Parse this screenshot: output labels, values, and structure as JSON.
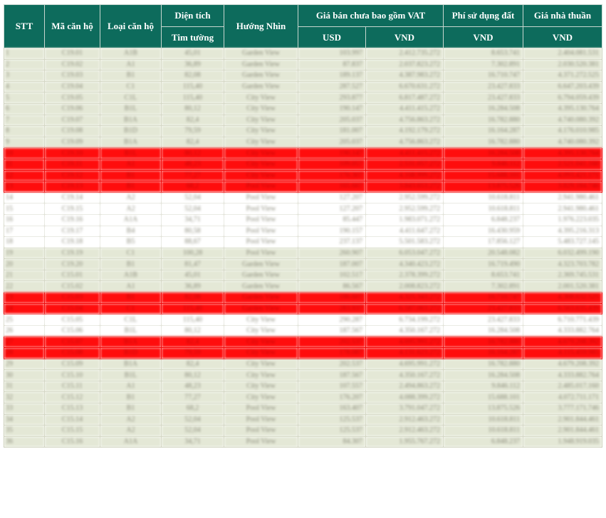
{
  "headers": {
    "stt": "STT",
    "ma_can_ho": "Mã căn hộ",
    "loai_can_ho": "Loại căn hộ",
    "dien_tich": "Diện tích",
    "tim_tuong": "Tim tường",
    "huong_nhin": "Hướng Nhìn",
    "gia_ban": "Giá bán chưa bao gồm VAT",
    "usd": "USD",
    "vnd": "VND",
    "phi_su_dung_dat": "Phí sử dụng đất",
    "phi_vnd": "VND",
    "gia_nha_thuan": "Giá nhà thuần",
    "gia_vnd": "VND"
  },
  "row_colors": {
    "normal": "#e4e8d6",
    "highlight_red": "#ff0d0d",
    "white": "#ffffff",
    "header_bg": "#0d6b5c"
  },
  "rows": [
    {
      "stt": "1",
      "ma": "C19.01",
      "loai": "A1B",
      "dt": "45,01",
      "huong": "Garden View",
      "usd": "103.997",
      "vnd": "2.412.735.272",
      "phi": "8.653.741",
      "gia": "2.404.081.531",
      "status": "green"
    },
    {
      "stt": "2",
      "ma": "C19.02",
      "loai": "A1",
      "dt": "36,89",
      "huong": "Garden View",
      "usd": "87.837",
      "vnd": "2.037.823.272",
      "phi": "7.302.891",
      "gia": "2.030.520.381",
      "status": "green"
    },
    {
      "stt": "3",
      "ma": "C19.03",
      "loai": "B1",
      "dt": "82,08",
      "huong": "Garden View",
      "usd": "189.137",
      "vnd": "4.387.983.272",
      "phi": "16.710.747",
      "gia": "4.371.272.525",
      "status": "green"
    },
    {
      "stt": "4",
      "ma": "C19.04",
      "loai": "C1",
      "dt": "115,40",
      "huong": "Garden View",
      "usd": "287.527",
      "vnd": "6.670.631.272",
      "phi": "23.427.833",
      "gia": "6.647.203.439",
      "status": "green"
    },
    {
      "stt": "5",
      "ma": "C19.05",
      "loai": "C1L",
      "dt": "115,40",
      "huong": "City View",
      "usd": "293.877",
      "vnd": "6.817.487.272",
      "phi": "23.427.833",
      "gia": "6.794.059.439",
      "status": "green"
    },
    {
      "stt": "6",
      "ma": "C19.06",
      "loai": "B1L",
      "dt": "80,12",
      "huong": "City View",
      "usd": "190.147",
      "vnd": "4.411.415.272",
      "phi": "16.284.508",
      "gia": "4.395.130.764",
      "status": "green"
    },
    {
      "stt": "7",
      "ma": "C19.07",
      "loai": "B1A",
      "dt": "82,4",
      "huong": "City View",
      "usd": "205.037",
      "vnd": "4.756.863.272",
      "phi": "16.782.880",
      "gia": "4.740.080.392",
      "status": "green"
    },
    {
      "stt": "8",
      "ma": "C19.08",
      "loai": "B1D",
      "dt": "79,59",
      "huong": "City View",
      "usd": "181.007",
      "vnd": "4.192.179.272",
      "phi": "16.164.287",
      "gia": "4.176.010.985",
      "status": "green"
    },
    {
      "stt": "9",
      "ma": "C19.09",
      "loai": "B1A",
      "dt": "82,4",
      "huong": "City View",
      "usd": "205.037",
      "vnd": "4.756.863.272",
      "phi": "16.782.880",
      "gia": "4.740.080.392",
      "status": "green"
    },
    {
      "stt": "10",
      "ma": "C19.10",
      "loai": "B1L",
      "dt": "80,12",
      "huong": "City View",
      "usd": "190.147",
      "vnd": "4.411.415.272",
      "phi": "16.284.508",
      "gia": "4.395.130.764",
      "status": "red"
    },
    {
      "stt": "11",
      "ma": "C19.11",
      "loai": "A1",
      "dt": "48,23",
      "huong": "City View",
      "usd": "109.057",
      "vnd": "2.531.057.272",
      "phi": "9.846.112",
      "gia": "2.521.041.160",
      "status": "red"
    },
    {
      "stt": "12",
      "ma": "C19.12",
      "loai": "B1",
      "dt": "77,27",
      "huong": "City View",
      "usd": "176.307",
      "vnd": "4.108.999.272",
      "phi": "15.688.101",
      "gia": "4.093.421.171",
      "status": "red"
    },
    {
      "stt": "13",
      "ma": "C19.13",
      "loai": "B1",
      "dt": "68,2",
      "huong": "Pool View",
      "usd": "165.667",
      "vnd": "3.843.653.272",
      "phi": "13.875.526",
      "gia": "3.829.184.746",
      "status": "red"
    },
    {
      "stt": "14",
      "ma": "C19.14",
      "loai": "A2",
      "dt": "52,04",
      "huong": "Pool View",
      "usd": "127.207",
      "vnd": "2.952.599.272",
      "phi": "10.618.811",
      "gia": "2.941.980.461",
      "status": "white"
    },
    {
      "stt": "15",
      "ma": "C19.15",
      "loai": "A2",
      "dt": "52,04",
      "huong": "Pool View",
      "usd": "127.207",
      "vnd": "2.952.599.272",
      "phi": "10.618.811",
      "gia": "2.941.980.461",
      "status": "white"
    },
    {
      "stt": "16",
      "ma": "C19.16",
      "loai": "A1A",
      "dt": "34,71",
      "huong": "Pool View",
      "usd": "85.447",
      "vnd": "1.983.071.272",
      "phi": "6.848.237",
      "gia": "1.976.223.035",
      "status": "white"
    },
    {
      "stt": "17",
      "ma": "C19.17",
      "loai": "B4",
      "dt": "80,58",
      "huong": "Pool View",
      "usd": "190.157",
      "vnd": "4.411.647.272",
      "phi": "16.430.959",
      "gia": "4.395.216.313",
      "status": "white"
    },
    {
      "stt": "18",
      "ma": "C19.18",
      "loai": "B5",
      "dt": "88,67",
      "huong": "Pool View",
      "usd": "237.137",
      "vnd": "5.501.583.272",
      "phi": "17.856.127",
      "gia": "5.483.727.145",
      "status": "white"
    },
    {
      "stt": "19",
      "ma": "C19.19",
      "loai": "C1",
      "dt": "100,28",
      "huong": "Pool View",
      "usd": "260.907",
      "vnd": "6.053.047.272",
      "phi": "20.548.082",
      "gia": "6.032.499.190",
      "status": "green"
    },
    {
      "stt": "20",
      "ma": "C19.20",
      "loai": "B1",
      "dt": "81,47",
      "huong": "Garden View",
      "usd": "187.007",
      "vnd": "4.340.423.272",
      "phi": "16.719.490",
      "gia": "4.323.703.782",
      "status": "green"
    },
    {
      "stt": "21",
      "ma": "C15.01",
      "loai": "A1B",
      "dt": "45,01",
      "huong": "Garden View",
      "usd": "102.517",
      "vnd": "2.378.399.272",
      "phi": "8.653.741",
      "gia": "2.369.745.531",
      "status": "green"
    },
    {
      "stt": "22",
      "ma": "C15.02",
      "loai": "A1",
      "dt": "36,89",
      "huong": "Garden View",
      "usd": "86.567",
      "vnd": "2.008.823.272",
      "phi": "7.302.891",
      "gia": "2.001.520.381",
      "status": "green"
    },
    {
      "stt": "23",
      "ma": "C15.03",
      "loai": "B1",
      "dt": "82,08",
      "huong": "Garden View",
      "usd": "186.607",
      "vnd": "4.325.343.272",
      "phi": "16.710.747",
      "gia": "4.308.632.525",
      "status": "red"
    },
    {
      "stt": "24",
      "ma": "C15.04",
      "loai": "C1",
      "dt": "115,40",
      "huong": "Garden View",
      "usd": "283.937",
      "vnd": "6.587.063.272",
      "phi": "23.427.833",
      "gia": "6.563.635.439",
      "status": "red"
    },
    {
      "stt": "25",
      "ma": "C15.05",
      "loai": "C1L",
      "dt": "115,40",
      "huong": "City View",
      "usd": "290.287",
      "vnd": "6.734.199.272",
      "phi": "23.427.833",
      "gia": "6.710.771.439",
      "status": "white"
    },
    {
      "stt": "26",
      "ma": "C15.06",
      "loai": "B1L",
      "dt": "80,12",
      "huong": "City View",
      "usd": "187.567",
      "vnd": "4.350.167.272",
      "phi": "16.284.508",
      "gia": "4.333.882.764",
      "status": "white"
    },
    {
      "stt": "27",
      "ma": "C15.07",
      "loai": "B1A",
      "dt": "82,4",
      "huong": "City View",
      "usd": "202.537",
      "vnd": "4.695.991.272",
      "phi": "16.782.880",
      "gia": "4.679.208.392",
      "status": "red"
    },
    {
      "stt": "28",
      "ma": "C15.08",
      "loai": "B1D",
      "dt": "79,59",
      "huong": "City View",
      "usd": "178.087",
      "vnd": "4.131.623.272",
      "phi": "16.164.287",
      "gia": "4.115.459.985",
      "status": "red"
    },
    {
      "stt": "29",
      "ma": "C15.09",
      "loai": "B1A",
      "dt": "82,4",
      "huong": "City View",
      "usd": "202.537",
      "vnd": "4.695.991.272",
      "phi": "16.782.880",
      "gia": "4.679.208.392",
      "status": "green"
    },
    {
      "stt": "30",
      "ma": "C15.10",
      "loai": "B1L",
      "dt": "80,12",
      "huong": "City View",
      "usd": "187.567",
      "vnd": "4.350.167.272",
      "phi": "16.284.508",
      "gia": "4.333.882.764",
      "status": "green"
    },
    {
      "stt": "31",
      "ma": "C15.11",
      "loai": "A1",
      "dt": "48,23",
      "huong": "City View",
      "usd": "107.557",
      "vnd": "2.494.863.272",
      "phi": "9.846.112",
      "gia": "2.485.017.160",
      "status": "green"
    },
    {
      "stt": "32",
      "ma": "C15.12",
      "loai": "B1",
      "dt": "77,27",
      "huong": "City View",
      "usd": "176.207",
      "vnd": "4.088.399.272",
      "phi": "15.688.101",
      "gia": "4.072.711.171",
      "status": "green"
    },
    {
      "stt": "33",
      "ma": "C15.13",
      "loai": "B1",
      "dt": "68,2",
      "huong": "Pool View",
      "usd": "163.407",
      "vnd": "3.791.047.272",
      "phi": "13.875.526",
      "gia": "3.777.171.746",
      "status": "green"
    },
    {
      "stt": "34",
      "ma": "C15.14",
      "loai": "A2",
      "dt": "52,04",
      "huong": "Pool View",
      "usd": "125.537",
      "vnd": "2.912.463.272",
      "phi": "10.618.811",
      "gia": "2.901.844.461",
      "status": "green"
    },
    {
      "stt": "35",
      "ma": "C15.15",
      "loai": "A2",
      "dt": "52,04",
      "huong": "Pool View",
      "usd": "125.537",
      "vnd": "2.912.463.272",
      "phi": "10.618.811",
      "gia": "2.901.844.461",
      "status": "green"
    },
    {
      "stt": "36",
      "ma": "C15.16",
      "loai": "A1A",
      "dt": "34,71",
      "huong": "Pool View",
      "usd": "84.307",
      "vnd": "1.955.767.272",
      "phi": "6.848.237",
      "gia": "1.948.919.035",
      "status": "green"
    }
  ]
}
